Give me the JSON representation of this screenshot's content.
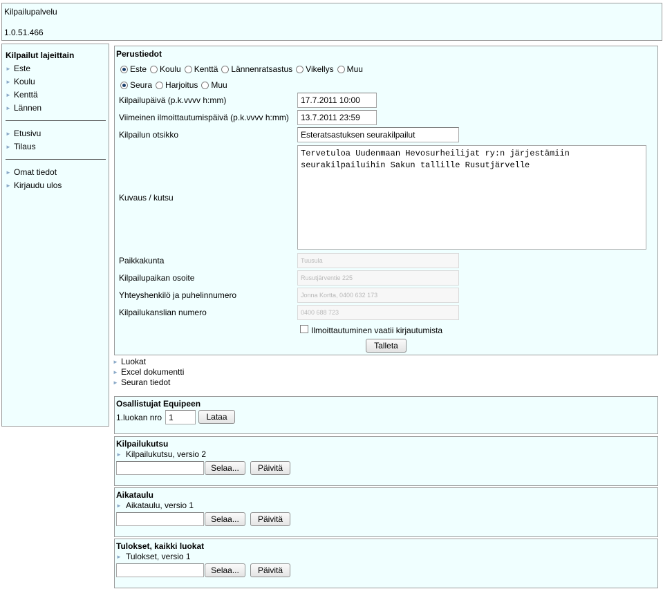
{
  "header": {
    "title": "Kilpailupalvelu",
    "version": "1.0.51.466"
  },
  "sidebar": {
    "heading": "Kilpailut lajeittain",
    "group1": [
      "Este",
      "Koulu",
      "Kenttä",
      "Lännen"
    ],
    "group2": [
      "Etusivu",
      "Tilaus"
    ],
    "group3": [
      "Omat tiedot",
      "Kirjaudu ulos"
    ]
  },
  "perustiedot": {
    "title": "Perustiedot",
    "discipline_options": [
      "Este",
      "Koulu",
      "Kenttä",
      "Lännenratsastus",
      "Vikellys",
      "Muu"
    ],
    "discipline_selected": "Este",
    "type_options": [
      "Seura",
      "Harjoitus",
      "Muu"
    ],
    "type_selected": "Seura",
    "date_label": "Kilpailupäivä (p.k.vvvv h:mm)",
    "date_value": "17.7.2011 10:00",
    "deadline_label": "Viimeinen ilmoittautumispäivä (p.k.vvvv h:mm)",
    "deadline_value": "13.7.2011 23:59",
    "title_label": "Kilpailun otsikko",
    "title_value": "Esteratsastuksen seurakilpailut",
    "desc_label": "Kuvaus / kutsu",
    "desc_value": "Tervetuloa Uudenmaan Hevosurheilijat ry:n järjestämiin seurakilpailuihin Sakun tallille Rusutjärvelle",
    "place_label": "Paikkakunta",
    "place_value": "Tuusula",
    "address_label": "Kilpailupaikan osoite",
    "address_value": "Rusutjärventie 225",
    "contact_label": "Yhteyshenkilö ja puhelinnumero",
    "contact_value": "Jonna Kortta, 0400 632 173",
    "office_label": "Kilpailukanslian numero",
    "office_value": "0400 688 723",
    "login_required_label": "Ilmoittautuminen vaatii kirjautumista",
    "save_label": "Talleta"
  },
  "links": [
    "Luokat",
    "Excel dokumentti",
    "Seuran tiedot"
  ],
  "equipe": {
    "title": "Osallistujat Equipeen",
    "class_label": "1.luokan nro",
    "class_value": "1",
    "load_label": "Lataa"
  },
  "documents": [
    {
      "title": "Kilpailukutsu",
      "item": "Kilpailukutsu, versio 2",
      "browse": "Selaa...",
      "update": "Päivitä"
    },
    {
      "title": "Aikataulu",
      "item": "Aikataulu, versio 1",
      "browse": "Selaa...",
      "update": "Päivitä"
    },
    {
      "title": "Tulokset, kaikki luokat",
      "item": "Tulokset, versio 1",
      "browse": "Selaa...",
      "update": "Päivitä"
    }
  ]
}
